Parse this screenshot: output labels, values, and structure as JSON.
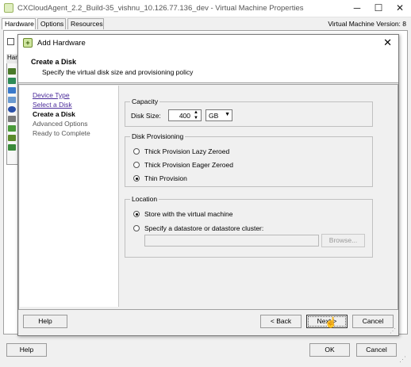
{
  "outer": {
    "title": "CXCloudAgent_2.2_Build-35_vishnu_10.126.77.136_dev - Virtual Machine Properties",
    "tabs": [
      {
        "label": "Hardware"
      },
      {
        "label": "Options"
      },
      {
        "label": "Resources"
      }
    ],
    "vm_version": "Virtual Machine Version: 8",
    "hardware_col_head": "Har",
    "help_label": "Help",
    "ok_label": "OK",
    "cancel_label": "Cancel"
  },
  "dialog": {
    "title": "Add Hardware",
    "header": {
      "title": "Create a Disk",
      "subtitle": "Specify the virtual disk size and provisioning policy"
    },
    "nav": [
      {
        "label": "Device Type",
        "state": "link"
      },
      {
        "label": "Select a Disk",
        "state": "link"
      },
      {
        "label": "Create a Disk",
        "state": "current"
      },
      {
        "label": "Advanced Options",
        "state": "future"
      },
      {
        "label": "Ready to Complete",
        "state": "future"
      }
    ],
    "capacity": {
      "group_label": "Capacity",
      "disk_size_label": "Disk Size:",
      "disk_size_value": "400",
      "unit": "GB"
    },
    "provisioning": {
      "group_label": "Disk Provisioning",
      "options": [
        {
          "label": "Thick Provision Lazy Zeroed",
          "selected": false
        },
        {
          "label": "Thick Provision Eager Zeroed",
          "selected": false
        },
        {
          "label": "Thin Provision",
          "selected": true
        }
      ]
    },
    "location": {
      "group_label": "Location",
      "options": [
        {
          "label": "Store with the virtual machine",
          "selected": true
        },
        {
          "label": "Specify a datastore or datastore cluster:",
          "selected": false
        }
      ],
      "datastore_value": "",
      "browse_label": "Browse..."
    },
    "footer": {
      "help_label": "Help",
      "back_label": "< Back",
      "next_label": "Next >",
      "cancel_label": "Cancel"
    }
  },
  "colors": {
    "link": "#4a2a9a",
    "accent_icon": "#6a8a2a"
  }
}
